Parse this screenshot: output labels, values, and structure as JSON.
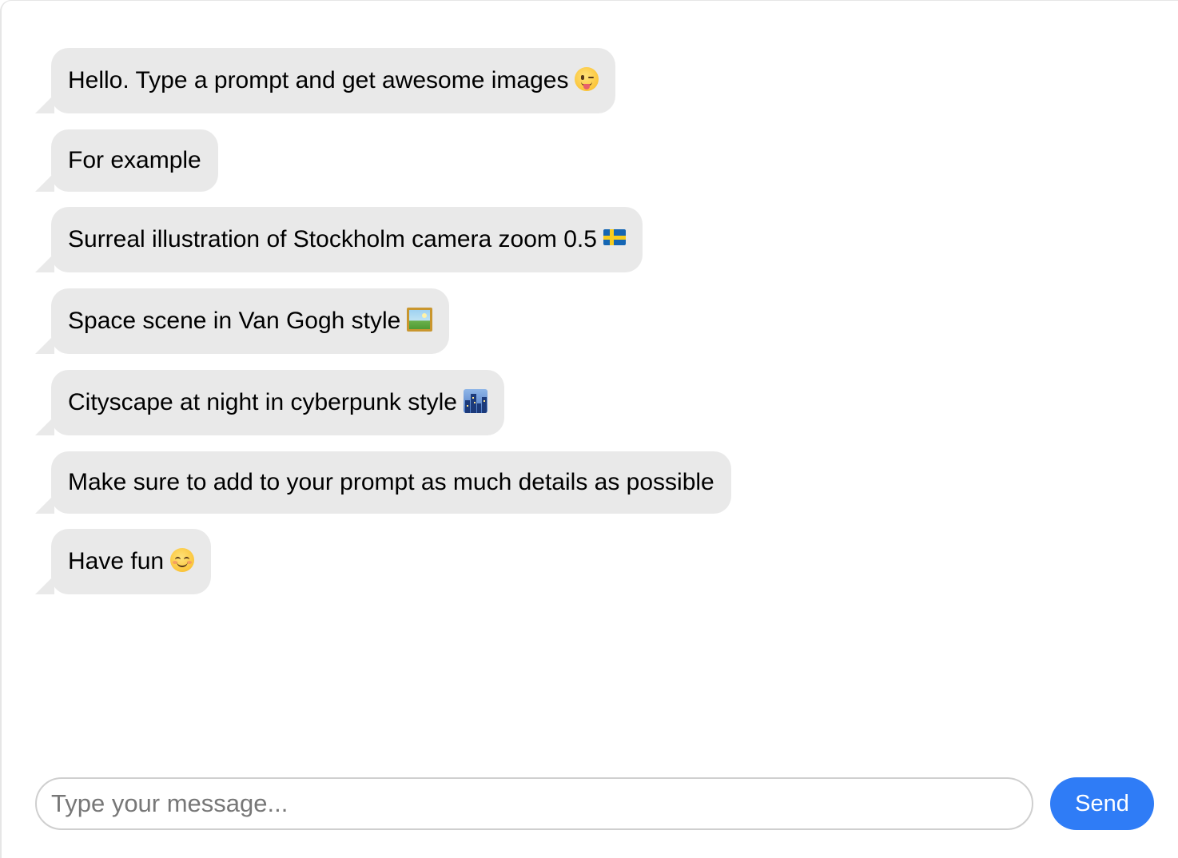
{
  "messages": [
    {
      "text": "Hello. Type a prompt and get awesome images",
      "emoji": "winking-face-with-tongue-icon"
    },
    {
      "text": "For example",
      "emoji": null
    },
    {
      "text": "Surreal illustration of Stockholm camera zoom 0.5",
      "emoji": "sweden-flag-icon"
    },
    {
      "text": "Space scene in Van Gogh style",
      "emoji": "framed-picture-icon"
    },
    {
      "text": "Cityscape at night in cyberpunk style",
      "emoji": "cityscape-icon"
    },
    {
      "text": "Make sure to add to your prompt as much details as possible",
      "emoji": null
    },
    {
      "text": "Have fun",
      "emoji": "smiling-face-icon"
    }
  ],
  "composer": {
    "placeholder": "Type your message...",
    "value": "",
    "send_label": "Send"
  },
  "colors": {
    "bubble_background": "#e9e9e9",
    "send_button": "#2f7cf6",
    "input_border": "#cfcfcf"
  }
}
